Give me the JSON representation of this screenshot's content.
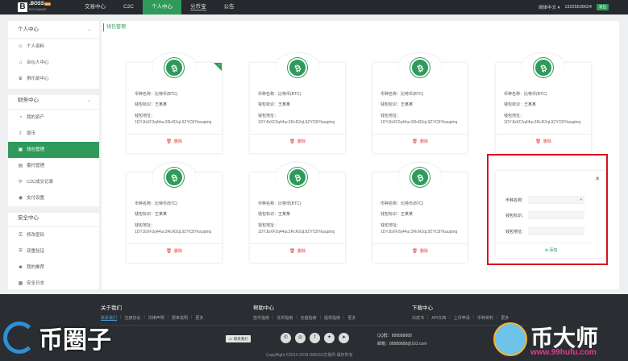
{
  "brand": {
    "mark": "B",
    "name": ".BOSS",
    "tag": "beta",
    "sub": "EXCHANGE"
  },
  "nav": {
    "items": [
      "交易中心",
      "C2C",
      "个人中心",
      "分币宝",
      "公告"
    ],
    "active_index": 2
  },
  "header": {
    "language": "简体中文",
    "phone": "13225635624",
    "logout": "退出"
  },
  "sidebar": {
    "groups": [
      {
        "title": "个人中心",
        "items": [
          "个人资料",
          "合伙人中心",
          "俱乐部中心"
        ]
      },
      {
        "title": "财务中心",
        "items": [
          "我的资产",
          "提币",
          "钱包管理",
          "委托管理",
          "C2C成交记录",
          "支付设置"
        ]
      },
      {
        "title": "安全中心",
        "items": [
          "修改密码",
          "双重验证",
          "我的推荐",
          "安全日志"
        ]
      }
    ],
    "active_item": "钱包管理"
  },
  "main": {
    "title": "钱包管理",
    "cards": [
      {
        "coin_label": "币种名称：比特币(BTC)",
        "tag_label": "钱包标识：王某某",
        "addr_label": "钱包地址：",
        "address": "1DYJbXF2q44uc3RcR2qL9ZYC8Ykauptnq",
        "delete": "删除",
        "default": true
      },
      {
        "coin_label": "币种名称：比特币(BTC)",
        "tag_label": "钱包标识：王某某",
        "addr_label": "钱包地址：",
        "address": "1DYJbXF2q44uc3RcR2qL9ZYC8Ykauptnq",
        "delete": "删除",
        "default": false
      },
      {
        "coin_label": "币种名称：比特币(BTC)",
        "tag_label": "钱包标识：王某某",
        "addr_label": "钱包地址：",
        "address": "1DYJbXF2q44uc3RcR2qL9ZYC8Ykauptnq",
        "delete": "删除",
        "default": false
      },
      {
        "coin_label": "币种名称：比特币(BTC)",
        "tag_label": "钱包标识：王某某",
        "addr_label": "钱包地址：",
        "address": "1DYJbXF2q44uc3RcR2qL9ZYC8Ykauptnq",
        "delete": "删除",
        "default": false
      },
      {
        "coin_label": "币种名称：比特币(BTC)",
        "tag_label": "钱包标识：王某某",
        "addr_label": "钱包地址：",
        "address": "1DYJbXF2q44uc3RcR2qL9ZYC8Ykauptnq",
        "delete": "删除",
        "default": false
      },
      {
        "coin_label": "币种名称：比特币(BTC)",
        "tag_label": "钱包标识：王某某",
        "addr_label": "钱包地址：",
        "address": "1DYJbXF2q44uc3RcR2qL9ZYC8Ykauptnq",
        "delete": "删除",
        "default": false
      },
      {
        "coin_label": "币种名称：比特币(BTC)",
        "tag_label": "钱包标识：王某某",
        "addr_label": "钱包地址：",
        "address": "1DYJbXF2q44uc3RcR2qL9ZYC8Ykauptnq",
        "delete": "删除",
        "default": false
      }
    ],
    "add_form": {
      "coin_label": "币种名称：",
      "tag_label": "钱包标识：",
      "addr_label": "钱包地址：",
      "submit": "添加"
    }
  },
  "footer": {
    "about": {
      "title": "关于我们",
      "links": [
        "联系我们",
        "注册协议",
        "法律声明",
        "费率说明",
        "更多"
      ]
    },
    "help": {
      "title": "帮助中心",
      "links": [
        "挂币指南",
        "充币指南",
        "充值指南",
        "提现指南",
        "更多"
      ]
    },
    "download": {
      "title": "下载中心",
      "links": [
        "白皮书",
        "API文档",
        "上币申请",
        "币种资料",
        "更多"
      ]
    },
    "contact_button": "联系我们",
    "qq": "QQ群：888888888",
    "email": "邮箱：88888888@163.com",
    "copyright": "CopyRight ©2013-2018 DBOSS交易所 版权所有"
  },
  "watermarks": {
    "left": "币圈子",
    "right": "币大师",
    "right_url": "www.99hufu.com"
  },
  "colors": {
    "accent": "#2f9a5b",
    "danger": "#e03c3c",
    "highlight": "#d8141f",
    "dark": "#26292d"
  }
}
